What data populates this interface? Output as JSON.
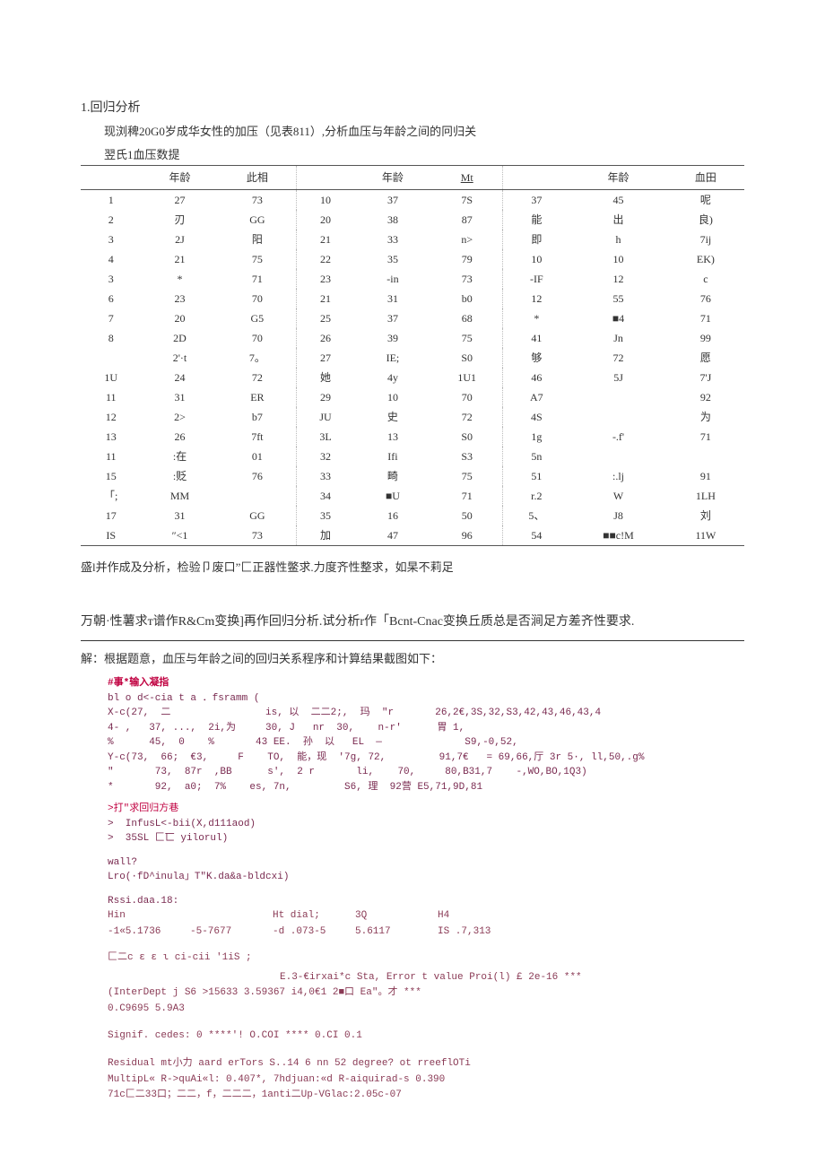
{
  "title": "1.回归分析",
  "intro": "现浏稗20G0岁成华女性的加压（见表811）,分析血压与年龄之间的冋归关",
  "table_caption": "翌氏1血压数提",
  "headers": {
    "age": "年龄",
    "bp": "此相",
    "mt": "Mt",
    "bp3": "血田"
  },
  "table": {
    "block1": [
      {
        "n": "1",
        "a": "27",
        "b": "73"
      },
      {
        "n": "2",
        "a": "刃",
        "b": "GG"
      },
      {
        "n": "3",
        "a": "2J",
        "b": "阳"
      },
      {
        "n": "4",
        "a": "21",
        "b": "75"
      },
      {
        "n": "3",
        "a": "*",
        "b": "71"
      },
      {
        "n": "6",
        "a": "23",
        "b": "70"
      },
      {
        "n": "7",
        "a": "20",
        "b": "G5"
      },
      {
        "n": "8",
        "a": "2D",
        "b": "70"
      },
      {
        "n": "",
        "a": "2'·t",
        "b": "7。"
      },
      {
        "n": "1U",
        "a": "24",
        "b": "72"
      },
      {
        "n": "11",
        "a": "31",
        "b": "ER"
      },
      {
        "n": "12",
        "a": "2>",
        "b": "b7"
      },
      {
        "n": "13",
        "a": "26",
        "b": "7ft"
      },
      {
        "n": "11",
        "a": ":在",
        "b": "01"
      },
      {
        "n": "15",
        "a": ":贬",
        "b": "76"
      },
      {
        "n": "「;",
        "a": "MM",
        "b": ""
      },
      {
        "n": "17",
        "a": "31",
        "b": "GG"
      },
      {
        "n": "IS",
        "a": "″<1",
        "b": "73"
      }
    ],
    "block2": [
      {
        "n": "10",
        "a": "37",
        "b": "7S"
      },
      {
        "n": "20",
        "a": "38",
        "b": "87"
      },
      {
        "n": "21",
        "a": "33",
        "b": "n>"
      },
      {
        "n": "22",
        "a": "35",
        "b": "79"
      },
      {
        "n": "23",
        "a": "-in",
        "b": "73"
      },
      {
        "n": "21",
        "a": "31",
        "b": "b0"
      },
      {
        "n": "25",
        "a": "37",
        "b": "68"
      },
      {
        "n": "26",
        "a": "39",
        "b": "75"
      },
      {
        "n": "27",
        "a": "IE;",
        "b": "S0"
      },
      {
        "n": "她",
        "a": "4y",
        "b": "1U1"
      },
      {
        "n": "29",
        "a": "10",
        "b": "70"
      },
      {
        "n": "JU",
        "a": "史",
        "b": "72"
      },
      {
        "n": "3L",
        "a": "13",
        "b": "S0"
      },
      {
        "n": "32",
        "a": "Ifi",
        "b": "S3"
      },
      {
        "n": "33",
        "a": "畸",
        "b": "75"
      },
      {
        "n": "34",
        "a": "■U",
        "b": "71"
      },
      {
        "n": "35",
        "a": "16",
        "b": "50"
      },
      {
        "n": "加",
        "a": "47",
        "b": "96"
      }
    ],
    "block3": [
      {
        "n": "37",
        "a": "45",
        "b": "呢"
      },
      {
        "n": "能",
        "a": "出",
        "b": "良)"
      },
      {
        "n": "即",
        "a": "h",
        "b": "7ij"
      },
      {
        "n": "10",
        "a": "10",
        "b": "EK)"
      },
      {
        "n": "-IF",
        "a": "12",
        "b": "c"
      },
      {
        "n": "12",
        "a": "55",
        "b": "76"
      },
      {
        "n": "*",
        "a": "■4",
        "b": "71"
      },
      {
        "n": "41",
        "a": "Jn",
        "b": "99"
      },
      {
        "n": "够",
        "a": "72",
        "b": "愿"
      },
      {
        "n": "46",
        "a": "5J",
        "b": "7'J"
      },
      {
        "n": "A7",
        "a": "",
        "b": "92"
      },
      {
        "n": "4S",
        "a": "",
        "b": "为"
      },
      {
        "n": "1g",
        "a": "-.f'",
        "b": "71"
      },
      {
        "n": "5n",
        "a": "",
        "b": ""
      },
      {
        "n": "51",
        "a": ":.lj",
        "b": "91"
      },
      {
        "n": "r.2",
        "a": "W",
        "b": "1LH"
      },
      {
        "n": "5、",
        "a": "J8",
        "b": "刘"
      },
      {
        "n": "54",
        "a": "■■c!M",
        "b": "11W"
      }
    ]
  },
  "para_after_table": "盛l并作成及分析，检验卩废口”匚正器性鳖求.力度齐性整求，如杲不莉足",
  "para_cont": "万朝·性薯求т谱作R&Cm变换]再作回归分析.试分析r作「Bcnt-Cnac变换丘质总是否涧足方差齐性要求.",
  "solution_lead": "解：根据题意，血压与年龄之间的回归关系程序和计算结果截图如下：",
  "code": {
    "c1": "#事*输入凝指",
    "c2": "bl o d<-cia t a ．fsramm (",
    "c3": "X-c(27,  二                is, 以  二二2;,  玛  \"r       26,2€,3S,32,S3,42,43,46,43,4",
    "c4": "4- ,   37, ...,  2i,为     30, J   nr  30,    n-r'      胃 1,",
    "c5": "%      45,  0    %       43 EE.  孙  以   EL  —              S9,-0,52,",
    "c6": "Y-c(73,  66;  €3,     F    TO,  能，现  '7g, 72,         91,7€   = 69,66,厅 3r 5·, ll,50,.g%",
    "c7": "\"       73,  87r  ,BB      s',  2 r       li,    70,     80,B31,7    -,WO,BO,1Q3)",
    "c8": "*       92,  a0;  7%    es, 7n,         S6, 理  92营 E5,71,9D,81",
    "c9": ">打\"求回归方巷",
    "c10": ">  InfusL<-bii(X,d111aod)",
    "c11": ">  35SL 匚匸 yilorul)",
    "c12": "wall?",
    "c13": "Lro(·fD^inula」T\"K.da&a-bldcxi)",
    "c14": "Rssi.daa.18:"
  },
  "resid": {
    "h1": "Hin",
    "h2": "Ht dial;",
    "h3": "3Q",
    "h4": "H4",
    "v1": "-1«5.1736",
    "v2": "-5-7677",
    "v3": "-d .073-5",
    "v4": "5.6117",
    "v5": "IS .7,313"
  },
  "coef_head": "匚二ϲ ε ε ι ci-cii '1iS ;",
  "coef_line": "E.3-€irxai*c Sta, Error t value  Proi(l) £ 2e-16 ***",
  "coef1": "(InterDept j S6 >15633         3.59367 i4,0€1    2■口 Ea\"。才  ***",
  "coef2": "                               0.C9695    5.9A3",
  "signif": "Signif. cedes: 0 ****'! O.COI **** 0.CI                            0.1",
  "footer1": "Residual mt小力 aard erTors S..14 6 nn 52 degree? ot rreeflOTi",
  "footer2": "MultipL« R->quAi«l: 0.407*,       7hdjuan:«d R-aiquirad-s 0.390",
  "footer3": "71c匚二33口；二二，f，二二二，1anti二Up-VGlac:2.05c-07"
}
